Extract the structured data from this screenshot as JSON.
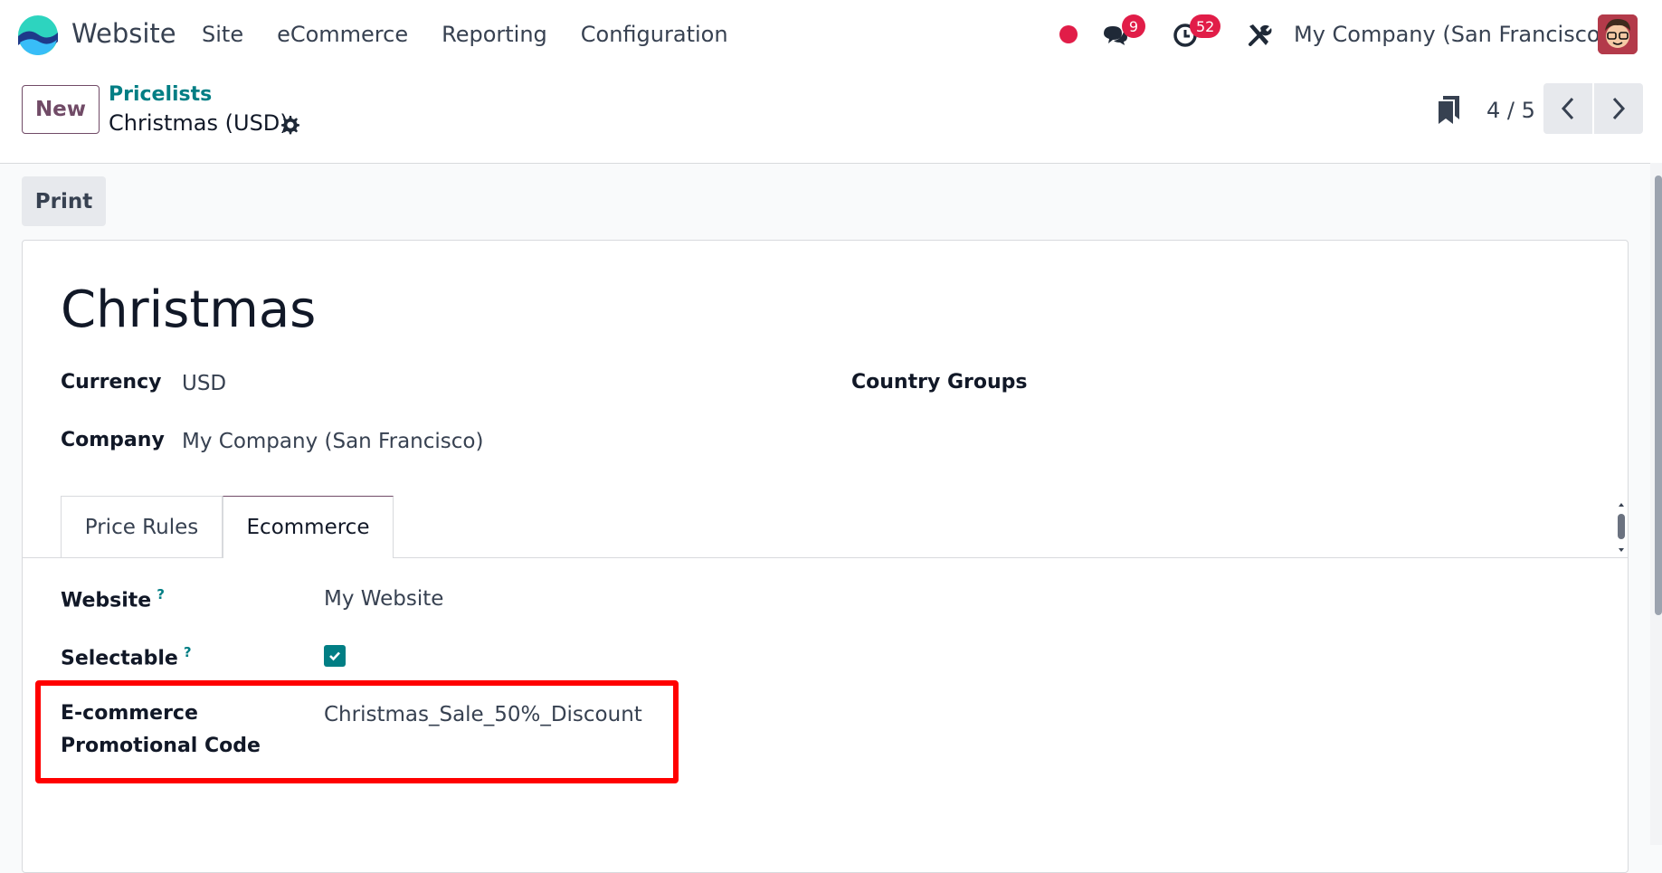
{
  "app": {
    "name": "Website",
    "menu": [
      "Site",
      "eCommerce",
      "Reporting",
      "Configuration"
    ]
  },
  "systray": {
    "messages_count": "9",
    "activities_count": "52",
    "company": "My Company (San Francisco)"
  },
  "control_panel": {
    "new_label": "New",
    "breadcrumb_parent": "Pricelists",
    "breadcrumb_current": "Christmas (USD)",
    "pager_value": "4 / 5"
  },
  "actions": {
    "print_label": "Print"
  },
  "form": {
    "title": "Christmas",
    "currency_label": "Currency",
    "currency_value": "USD",
    "company_label": "Company",
    "company_value": "My Company (San Francisco)",
    "country_groups_label": "Country Groups",
    "tabs": [
      "Price Rules",
      "Ecommerce"
    ],
    "active_tab": "Ecommerce",
    "website_label": "Website",
    "website_value": "My Website",
    "selectable_label": "Selectable",
    "selectable_checked": true,
    "promo_label_line1": "E-commerce",
    "promo_label_line2": "Promotional Code",
    "promo_value": "Christmas_Sale_50%_Discount",
    "help_mark": "?"
  },
  "colors": {
    "brand": "#714b67",
    "link": "#017e84",
    "badge": "#e11d48",
    "highlight": "#ff0000"
  }
}
